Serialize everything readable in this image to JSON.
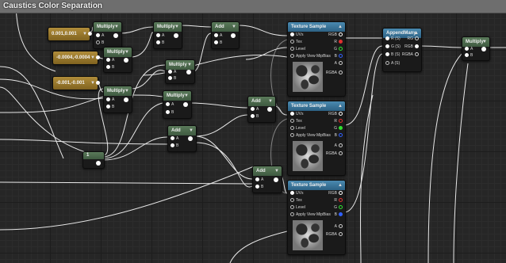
{
  "window": {
    "title": "Caustics Color Separation"
  },
  "constants": [
    {
      "value": "0.001,0.001"
    },
    {
      "value": "-0.0004,-0.0004"
    },
    {
      "value": "-0.001,-0.001"
    },
    {
      "value": "1"
    }
  ],
  "labels": {
    "multiply": "Multiply",
    "add": "Add",
    "texture_sample": "Texture Sample",
    "append_many": "AppendMany",
    "pin_a": "A",
    "pin_b": "B",
    "uvs": "UVs",
    "tex": "Tex",
    "level": "Level",
    "apply_view_mipbias": "Apply View MipBias",
    "rgb": "RGB",
    "r": "R",
    "g": "G",
    "bch": "B",
    "a": "A",
    "rgba": "RGBA",
    "in_r": "R (S)",
    "in_g": "G (S)",
    "in_b": "B (S)",
    "in_a": "A (S)",
    "out_rg": "RG",
    "out_rgb": "RGB",
    "out_rgba": "RGBA"
  },
  "colors": {
    "red": "#e03030",
    "green": "#30e030",
    "blue": "#3060ff",
    "white": "#ffffff"
  }
}
